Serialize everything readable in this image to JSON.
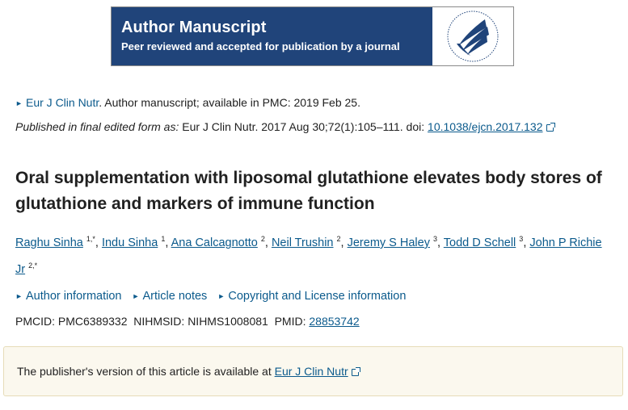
{
  "banner": {
    "title": "Author Manuscript",
    "subtitle": "Peer reviewed and accepted for publication by a journal",
    "logo_icon": "hhs-eagle-seal-icon"
  },
  "journal_line": {
    "journal": "Eur J Clin Nutr",
    "rest": ". Author manuscript; available in PMC: 2019 Feb 25."
  },
  "published_line": {
    "prefix": "Published in final edited form as:",
    "citation": " Eur J Clin Nutr. 2017 Aug 30;72(1):105–111. doi: ",
    "doi": "10.1038/ejcn.2017.132"
  },
  "title": "Oral supplementation with liposomal glutathione elevates body stores of glutathione and markers of immune function",
  "authors": [
    {
      "name": "Raghu Sinha",
      "sup": "1,*"
    },
    {
      "name": "Indu Sinha",
      "sup": "1"
    },
    {
      "name": "Ana Calcagnotto",
      "sup": "2"
    },
    {
      "name": "Neil Trushin",
      "sup": "2"
    },
    {
      "name": "Jeremy S Haley",
      "sup": "3"
    },
    {
      "name": "Todd D Schell",
      "sup": "3"
    },
    {
      "name": "John P Richie Jr",
      "sup": "2,*"
    }
  ],
  "notes": {
    "author_info": "Author information",
    "article_notes": "Article notes",
    "copyright": "Copyright and License information"
  },
  "ids": {
    "pmcid_label": "PMCID:",
    "pmcid": "PMC6389332",
    "nihmsid_label": "NIHMSID:",
    "nihmsid": "NIHMS1008081",
    "pmid_label": "PMID:",
    "pmid": "28853742"
  },
  "publisher_box": {
    "text": "The publisher's version of this article is available at ",
    "link": "Eur J Clin Nutr"
  },
  "colors": {
    "banner_bg": "#20447a",
    "link": "#0b5a8c",
    "notice_bg": "#fbf8ee"
  }
}
